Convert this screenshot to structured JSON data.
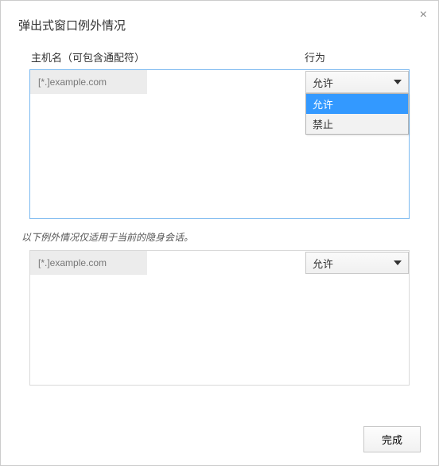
{
  "dialog": {
    "title": "弹出式窗口例外情况",
    "close_symbol": "×"
  },
  "headers": {
    "host": "主机名（可包含通配符）",
    "behavior": "行为"
  },
  "main_list": {
    "rows": [
      {
        "host_placeholder": "[*.]example.com",
        "behavior_selected": "允许",
        "dropdown_open": true,
        "options": [
          "允许",
          "禁止"
        ]
      }
    ]
  },
  "incognito_note": "以下例外情况仅适用于当前的隐身会话。",
  "incognito_list": {
    "rows": [
      {
        "host_placeholder": "[*.]example.com",
        "behavior_selected": "允许",
        "dropdown_open": false
      }
    ]
  },
  "footer": {
    "done_label": "完成"
  }
}
